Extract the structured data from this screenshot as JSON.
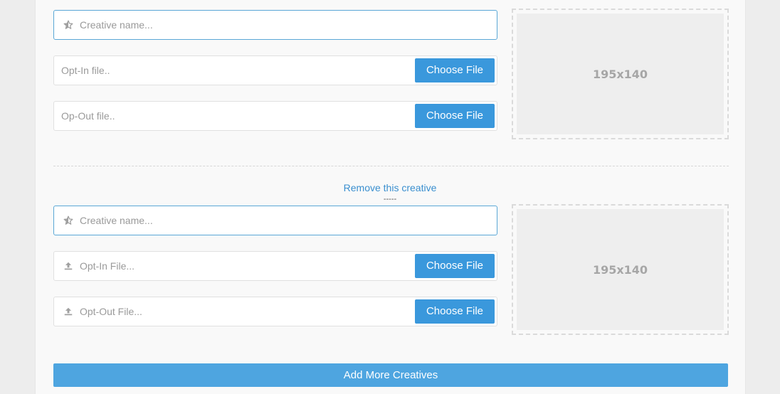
{
  "creatives": [
    {
      "name_placeholder": "Creative name...",
      "optin_placeholder": "Opt-In file..",
      "optout_placeholder": "Op-Out file..",
      "choose_file_label": "Choose File",
      "preview_size": "195x140"
    },
    {
      "remove_label": "Remove this creative",
      "separator": "-----",
      "name_placeholder": "Creative name...",
      "optin_placeholder": "Opt-In File...",
      "optout_placeholder": "Opt-Out File...",
      "choose_file_label": "Choose File",
      "preview_size": "195x140"
    }
  ],
  "add_more_label": "Add More Creatives",
  "colors": {
    "accent": "#3a98dc",
    "add_button": "#4ea5e0",
    "link": "#3a8fcf",
    "focus_border": "#5aa7d6"
  },
  "icons": {
    "name_field": "star-half-icon",
    "file_field": "upload-icon"
  }
}
